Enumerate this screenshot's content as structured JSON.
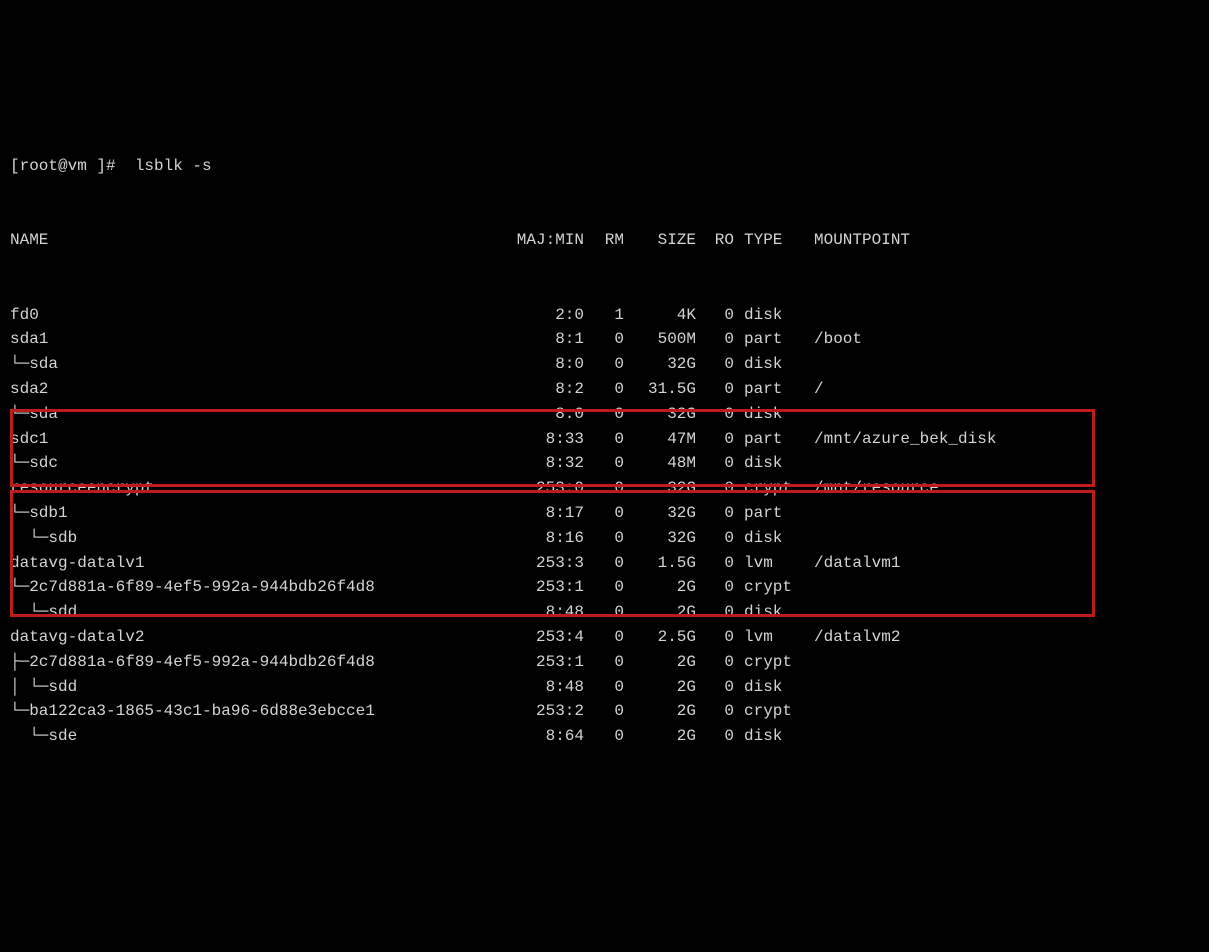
{
  "prompt": "[root@vm ]#  lsblk -s",
  "headers": {
    "name": "NAME",
    "majmin": "MAJ:MIN",
    "rm": "RM",
    "size": "SIZE",
    "ro": "RO",
    "type": "TYPE",
    "mount": "MOUNTPOINT"
  },
  "rows": [
    {
      "name": "fd0",
      "majmin": "2:0",
      "rm": "1",
      "size": "4K",
      "ro": "0",
      "type": "disk",
      "mount": ""
    },
    {
      "name": "sda1",
      "majmin": "8:1",
      "rm": "0",
      "size": "500M",
      "ro": "0",
      "type": "part",
      "mount": "/boot"
    },
    {
      "name": "└─sda",
      "majmin": "8:0",
      "rm": "0",
      "size": "32G",
      "ro": "0",
      "type": "disk",
      "mount": ""
    },
    {
      "name": "sda2",
      "majmin": "8:2",
      "rm": "0",
      "size": "31.5G",
      "ro": "0",
      "type": "part",
      "mount": "/"
    },
    {
      "name": "└─sda",
      "majmin": "8:0",
      "rm": "0",
      "size": "32G",
      "ro": "0",
      "type": "disk",
      "mount": ""
    },
    {
      "name": "sdc1",
      "majmin": "8:33",
      "rm": "0",
      "size": "47M",
      "ro": "0",
      "type": "part",
      "mount": "/mnt/azure_bek_disk"
    },
    {
      "name": "└─sdc",
      "majmin": "8:32",
      "rm": "0",
      "size": "48M",
      "ro": "0",
      "type": "disk",
      "mount": ""
    },
    {
      "name": "resourceencrypt",
      "majmin": "253:0",
      "rm": "0",
      "size": "32G",
      "ro": "0",
      "type": "crypt",
      "mount": "/mnt/resource"
    },
    {
      "name": "└─sdb1",
      "majmin": "8:17",
      "rm": "0",
      "size": "32G",
      "ro": "0",
      "type": "part",
      "mount": ""
    },
    {
      "name": "  └─sdb",
      "majmin": "8:16",
      "rm": "0",
      "size": "32G",
      "ro": "0",
      "type": "disk",
      "mount": ""
    },
    {
      "name": "datavg-datalv1",
      "majmin": "253:3",
      "rm": "0",
      "size": "1.5G",
      "ro": "0",
      "type": "lvm",
      "mount": "/datalvm1"
    },
    {
      "name": "└─2c7d881a-6f89-4ef5-992a-944bdb26f4d8",
      "majmin": "253:1",
      "rm": "0",
      "size": "2G",
      "ro": "0",
      "type": "crypt",
      "mount": ""
    },
    {
      "name": "  └─sdd",
      "majmin": "8:48",
      "rm": "0",
      "size": "2G",
      "ro": "0",
      "type": "disk",
      "mount": ""
    },
    {
      "name": "datavg-datalv2",
      "majmin": "253:4",
      "rm": "0",
      "size": "2.5G",
      "ro": "0",
      "type": "lvm",
      "mount": "/datalvm2"
    },
    {
      "name": "├─2c7d881a-6f89-4ef5-992a-944bdb26f4d8",
      "majmin": "253:1",
      "rm": "0",
      "size": "2G",
      "ro": "0",
      "type": "crypt",
      "mount": ""
    },
    {
      "name": "│ └─sdd",
      "majmin": "8:48",
      "rm": "0",
      "size": "2G",
      "ro": "0",
      "type": "disk",
      "mount": ""
    },
    {
      "name": "└─ba122ca3-1865-43c1-ba96-6d88e3ebcce1",
      "majmin": "253:2",
      "rm": "0",
      "size": "2G",
      "ro": "0",
      "type": "crypt",
      "mount": ""
    },
    {
      "name": "  └─sde",
      "majmin": "8:64",
      "rm": "0",
      "size": "2G",
      "ro": "0",
      "type": "disk",
      "mount": ""
    }
  ]
}
